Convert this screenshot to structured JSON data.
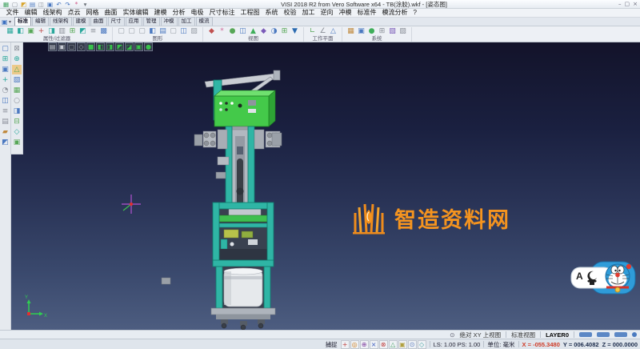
{
  "colors": {
    "canvas_top": "#13132a",
    "canvas_bottom": "#4d5d80",
    "watermark_orange": "#f5941f",
    "machine_teal": "#2fb5a5",
    "machine_green": "#44c94a",
    "coord_x_red": "#d03c28",
    "status_button_blue": "#5b87c5"
  },
  "titlebar": {
    "title": "VISI 2018 R2 from Vero Software x64 - TB(涂胶).wkf - [姿态图]",
    "quick_icons": [
      {
        "g": "▦",
        "c": "#3aa05a"
      },
      {
        "g": "▢",
        "c": "#8a9099"
      },
      {
        "g": "◩",
        "c": "#d9a62e"
      },
      {
        "g": "▤",
        "c": "#4a78c0"
      },
      {
        "g": "◫",
        "c": "#8a9099"
      },
      {
        "g": "▣",
        "c": "#4a78c0"
      },
      {
        "g": "↶",
        "c": "#3e6fbe"
      },
      {
        "g": "↷",
        "c": "#3e6fbe"
      },
      {
        "g": "*",
        "c": "#d05a8a"
      },
      {
        "g": "▾",
        "c": "#6a7078"
      }
    ],
    "window_controls": [
      {
        "g": "–"
      },
      {
        "g": "▢"
      },
      {
        "g": "×"
      }
    ]
  },
  "menu": {
    "items": [
      "文件",
      "编辑",
      "线架构",
      "点云",
      "网格",
      "曲面",
      "实体编辑",
      "建模",
      "分析",
      "电极",
      "尺寸标注",
      "工程图",
      "系统",
      "校验",
      "加工",
      "逆向",
      "冲模",
      "标准件",
      "模流分析",
      "?"
    ]
  },
  "tabs": {
    "menu_icon": "▣",
    "caret": "▾",
    "items": [
      {
        "label": "标准",
        "selected": true
      },
      {
        "label": "编辑"
      },
      {
        "label": "线架构"
      },
      {
        "label": "建模"
      },
      {
        "label": "曲面"
      },
      {
        "label": "尺寸"
      },
      {
        "label": "应用"
      },
      {
        "label": "管理"
      },
      {
        "label": "冲模"
      },
      {
        "label": "加工"
      },
      {
        "label": "模流"
      }
    ]
  },
  "ribbon": {
    "groups": [
      {
        "label": "属性/过滤器",
        "icons": [
          {
            "g": "▦",
            "c": "#2aa79b"
          },
          {
            "g": "◧",
            "c": "#2aa79b"
          },
          {
            "g": "▣",
            "c": "#57a757"
          },
          {
            "g": "+",
            "c": "#c05050"
          },
          {
            "g": "◨",
            "c": "#2aa79b"
          },
          {
            "g": "▥",
            "c": "#8a8f98"
          },
          {
            "g": "⊞",
            "c": "#57a757"
          },
          {
            "g": "◩",
            "c": "#2aa79b"
          },
          {
            "g": "≡",
            "c": "#8a8f98"
          },
          {
            "g": "▩",
            "c": "#4a78c0"
          }
        ]
      },
      {
        "label": "图形",
        "icons": [
          {
            "g": "▢",
            "c": "#9aa0a8"
          },
          {
            "g": "▢",
            "c": "#9aa0a8"
          },
          {
            "g": "▢",
            "c": "#9aa0a8"
          },
          {
            "g": "◧",
            "c": "#4a78c0"
          },
          {
            "g": "▤",
            "c": "#4a78c0"
          },
          {
            "g": "▢",
            "c": "#9aa0a8"
          },
          {
            "g": "◫",
            "c": "#4a78c0"
          },
          {
            "g": "▨",
            "c": "#9aa0a8"
          }
        ]
      },
      {
        "label": "视图",
        "icons": [
          {
            "g": "◆",
            "c": "#c05050"
          },
          {
            "g": "*",
            "c": "#d06a9a"
          },
          {
            "g": "●",
            "c": "#57a757"
          },
          {
            "g": "◫",
            "c": "#4a78c0"
          },
          {
            "g": "▲",
            "c": "#3fae5a"
          },
          {
            "g": "◆",
            "c": "#7a5ab8"
          },
          {
            "g": "◑",
            "c": "#4a78c0"
          },
          {
            "g": "⊞",
            "c": "#57a757"
          },
          {
            "g": "▼",
            "c": "#2a6ab0"
          }
        ]
      },
      {
        "label": "工作平面",
        "icons": [
          {
            "g": "∟",
            "c": "#57a757"
          },
          {
            "g": "∠",
            "c": "#8a8f98"
          },
          {
            "g": "△",
            "c": "#4a78c0"
          }
        ]
      },
      {
        "label": "系统",
        "icons": [
          {
            "g": "▦",
            "c": "#c08a3e"
          },
          {
            "g": "▣",
            "c": "#4a78c0"
          },
          {
            "g": "●",
            "c": "#3fae5a"
          },
          {
            "g": "⊞",
            "c": "#8a8f98"
          },
          {
            "g": "▧",
            "c": "#7a5ab8"
          },
          {
            "g": "▨",
            "c": "#8a8f98"
          }
        ]
      }
    ]
  },
  "dock": {
    "col1": [
      {
        "g": "▢",
        "c": "#4a78c0"
      },
      {
        "g": "⊞",
        "c": "#2aa79b"
      },
      {
        "g": "▣",
        "c": "#4a78c0"
      },
      {
        "g": "+",
        "c": "#2aa79b"
      },
      {
        "g": "◔",
        "c": "#8a8f98"
      },
      {
        "g": "◫",
        "c": "#4a78c0"
      },
      {
        "g": "≡",
        "c": "#8a8f98"
      },
      {
        "g": "▤",
        "c": "#8a8f98"
      },
      {
        "g": "▰",
        "c": "#c08a3e"
      },
      {
        "g": "◩",
        "c": "#4a78c0"
      }
    ],
    "col2": [
      {
        "g": "⊠",
        "c": "#8a8f98"
      },
      {
        "g": "⊕",
        "c": "#2aa79b"
      },
      {
        "g": "△",
        "c": "#57a757",
        "bg": "#ecc98a"
      },
      {
        "g": "▧",
        "c": "#4a78c0"
      },
      {
        "g": "▦",
        "c": "#57a757"
      },
      {
        "g": "○",
        "c": "#8a8f98"
      },
      {
        "g": "◨",
        "c": "#4a78c0"
      },
      {
        "g": "⊟",
        "c": "#57a757"
      },
      {
        "g": "◇",
        "c": "#2aa79b"
      },
      {
        "g": "▣",
        "c": "#57a757"
      }
    ]
  },
  "view_toolbar": {
    "icons": [
      {
        "g": "▤",
        "c": "#c8ccd4"
      },
      {
        "g": "▣",
        "c": "#c8ccd4"
      },
      {
        "g": "▢",
        "c": "#9aa0a8"
      },
      {
        "g": "◇",
        "c": "#9aa0a8"
      },
      {
        "g": "■",
        "c": "#39c24d"
      },
      {
        "g": "◧",
        "c": "#39c24d"
      },
      {
        "g": "◨",
        "c": "#39c24d"
      },
      {
        "g": "◩",
        "c": "#39c24d"
      },
      {
        "g": "◪",
        "c": "#39c24d"
      },
      {
        "g": "▣",
        "c": "#39c24d"
      },
      {
        "g": "●",
        "c": "#39c24d"
      }
    ]
  },
  "watermark": {
    "text": "智造资料网",
    "color": "#f5941f"
  },
  "ime": {
    "letter": "A"
  },
  "status1": {
    "icon": "⊙",
    "workplane": "绝对 XY 上视图",
    "view": "标准视图",
    "layer": "LAYER0"
  },
  "snap": {
    "label": "捕捉",
    "icons": [
      {
        "g": "+",
        "c": "#c04040"
      },
      {
        "g": "◎",
        "c": "#d08020"
      },
      {
        "g": "⊕",
        "c": "#8040a0"
      },
      {
        "g": "×",
        "c": "#4060c0"
      },
      {
        "g": "⊗",
        "c": "#c04040"
      },
      {
        "g": "△",
        "c": "#40a060"
      },
      {
        "g": "▣",
        "c": "#b0a040"
      },
      {
        "g": "⊙",
        "c": "#6080c0"
      },
      {
        "g": "◇",
        "c": "#40a0a0"
      }
    ]
  },
  "status2": {
    "ls_ps": "LS: 1.00 PS: 1.00",
    "units": "单位: 毫米",
    "x": "X = -055.3480",
    "y": "Y = 006.4082",
    "z": "Z = 000.0000"
  }
}
